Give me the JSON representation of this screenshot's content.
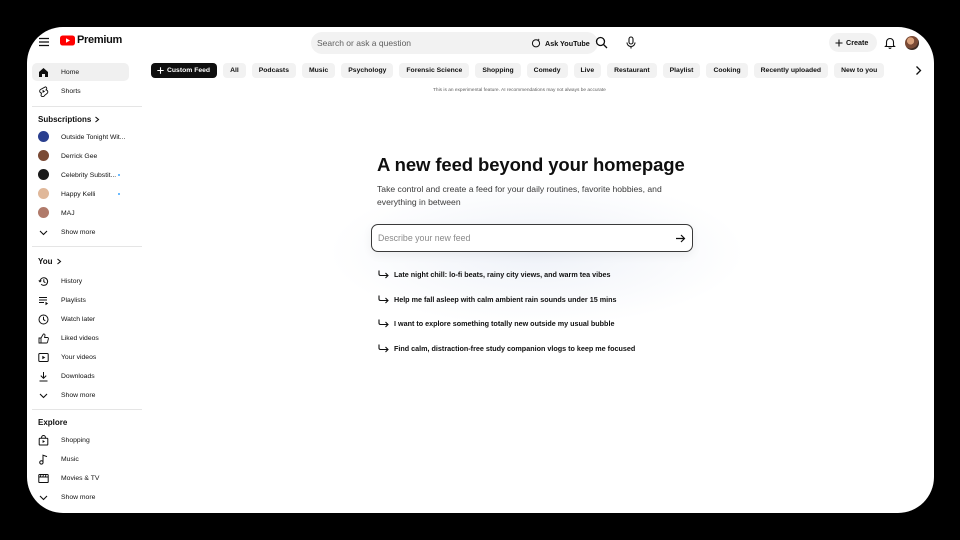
{
  "brand": {
    "logo_text": "Premium",
    "logo_color": "#ff0000"
  },
  "search": {
    "placeholder": "Search or ask a question",
    "ask_label": "Ask YouTube"
  },
  "header": {
    "create_label": "Create"
  },
  "sidebar": {
    "main": [
      {
        "label": "Home",
        "icon": "home-icon"
      },
      {
        "label": "Shorts",
        "icon": "shorts-icon"
      }
    ],
    "subscriptions_title": "Subscriptions",
    "subscriptions": [
      {
        "label": "Outside Tonight Wit...",
        "avatar_color": "#2a3f8f",
        "new": false
      },
      {
        "label": "Derrick Gee",
        "avatar_color": "#7a4a35",
        "new": false
      },
      {
        "label": "Celebrity Substit...",
        "avatar_color": "#1a1a1a",
        "new": true
      },
      {
        "label": "Happy Kelli",
        "avatar_color": "#e0b89a",
        "new": true
      },
      {
        "label": "MAJ",
        "avatar_color": "#b07a6a",
        "new": false
      }
    ],
    "subs_show_more": "Show more",
    "you_title": "You",
    "you_items": [
      {
        "label": "History",
        "icon": "history-icon"
      },
      {
        "label": "Playlists",
        "icon": "playlists-icon"
      },
      {
        "label": "Watch later",
        "icon": "watch-later-icon"
      },
      {
        "label": "Liked videos",
        "icon": "like-icon"
      },
      {
        "label": "Your videos",
        "icon": "your-videos-icon"
      },
      {
        "label": "Downloads",
        "icon": "download-icon"
      }
    ],
    "you_show_more": "Show more",
    "explore_title": "Explore",
    "explore_items": [
      {
        "label": "Shopping",
        "icon": "shopping-icon"
      },
      {
        "label": "Music",
        "icon": "music-icon"
      },
      {
        "label": "Movies & TV",
        "icon": "movies-icon"
      }
    ],
    "explore_show_more": "Show more"
  },
  "chips": [
    "Custom Feed",
    "All",
    "Podcasts",
    "Music",
    "Psychology",
    "Forensic Science",
    "Shopping",
    "Comedy",
    "Live",
    "Restaurant",
    "Playlist",
    "Cooking",
    "Recently uploaded",
    "New to you"
  ],
  "disclaimer": "This is an experimental feature. AI recommendations may not always be accurate",
  "main": {
    "headline": "A new feed beyond your homepage",
    "subline": "Take control and create a feed for your daily routines, favorite hobbies, and everything in between",
    "input_placeholder": "Describe your new feed",
    "suggestions": [
      "Late night chill: lo-fi beats, rainy city views, and warm tea vibes",
      "Help me fall asleep with calm ambient rain sounds under 15 mins",
      "I want to explore something totally new outside my usual bubble",
      "Find calm, distraction-free study companion vlogs to keep me focused"
    ]
  }
}
